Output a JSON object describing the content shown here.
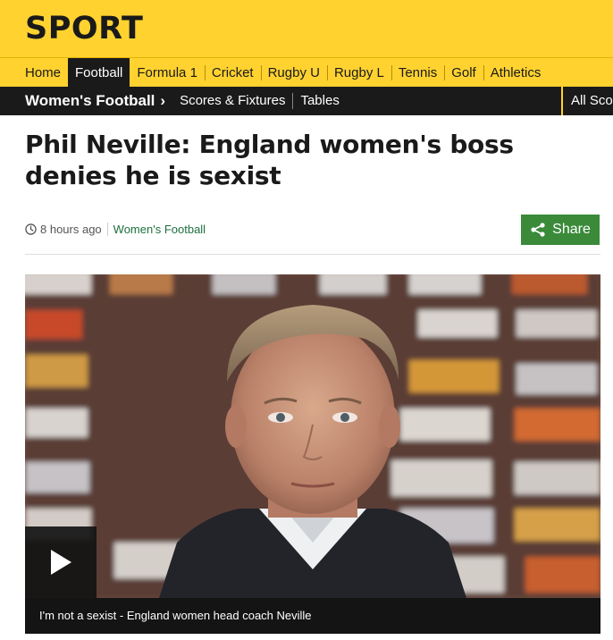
{
  "masthead": {
    "title": "SPORT"
  },
  "primary_nav": {
    "items": [
      {
        "label": "Home"
      },
      {
        "label": "Football",
        "active": true
      },
      {
        "label": "Formula 1"
      },
      {
        "label": "Cricket"
      },
      {
        "label": "Rugby U"
      },
      {
        "label": "Rugby L"
      },
      {
        "label": "Tennis"
      },
      {
        "label": "Golf"
      },
      {
        "label": "Athletics"
      }
    ]
  },
  "secondary_nav": {
    "current": "Women's Football",
    "links": [
      "Scores & Fixtures",
      "Tables"
    ],
    "all_sport": "All Sco"
  },
  "article": {
    "headline": "Phil Neville: England women's boss denies he is sexist",
    "timestamp": "8 hours ago",
    "section_link": "Women's Football",
    "share_label": "Share"
  },
  "media": {
    "caption": "I'm not a sexist - England women head coach Neville",
    "play_icon": "play-icon"
  },
  "colors": {
    "brand_yellow": "#ffd230",
    "nav_dark": "#1a1a1a",
    "share_green": "#3a8a3a",
    "link_green": "#1e6f3f"
  }
}
